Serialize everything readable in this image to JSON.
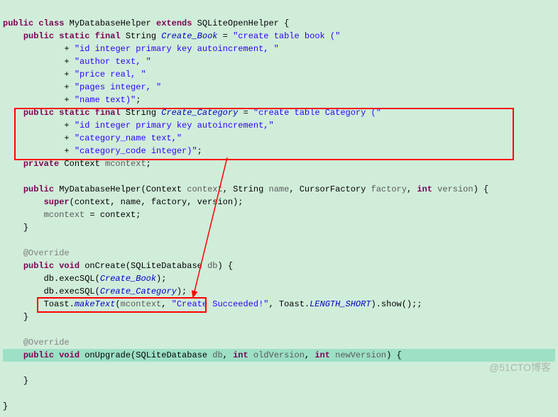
{
  "line1": {
    "a": "public class ",
    "b": "MyDatabaseHelper ",
    "c": "extends ",
    "d": "SQLiteOpenHelper {"
  },
  "line2": {
    "a": "public static final ",
    "b": "String ",
    "c": "Create_Book",
    "d": " = ",
    "e": "\"create table book (\""
  },
  "line3": {
    "a": "+ ",
    "b": "\"id integer primary key autoincrement, \""
  },
  "line4": {
    "a": "+ ",
    "b": "\"author text, \""
  },
  "line5": {
    "a": "+ ",
    "b": "\"price real, \""
  },
  "line6": {
    "a": "+ ",
    "b": "\"pages integer, \""
  },
  "line7": {
    "a": "+ ",
    "b": "\"name text)\"",
    "c": ";"
  },
  "line8": {
    "a": "public static final ",
    "b": "String ",
    "c": "Create_Category",
    "d": " = ",
    "e": "\"create table Category (\""
  },
  "line9": {
    "a": "+ ",
    "b": "\"id integer primary key autoincrement,\""
  },
  "line10": {
    "a": "+ ",
    "b": "\"category_name text,\""
  },
  "line11": {
    "a": "+ ",
    "b": "\"category_code integer)\"",
    "c": ";"
  },
  "line12": {
    "a": "private ",
    "b": "Context ",
    "c": "mcontext",
    "d": ";"
  },
  "line13": {
    "a": "public ",
    "b": "MyDatabaseHelper(Context ",
    "c": "context",
    "d": ", String ",
    "e": "name",
    "f": ", CursorFactory ",
    "g": "factory",
    "h": ", ",
    "i": "int ",
    "j": "version",
    "k": ") {"
  },
  "line14": {
    "a": "super",
    "b": "(context, name, factory, version);"
  },
  "line15": {
    "a": "mcontext",
    "b": " = context;"
  },
  "line16": {
    "a": "}"
  },
  "line17": {
    "a": "@Override"
  },
  "line18": {
    "a": "public void ",
    "b": "onCreate(SQLiteDatabase ",
    "c": "db",
    "d": ") {"
  },
  "line19": {
    "a": "db.execSQL(",
    "b": "Create_Book",
    "c": ");"
  },
  "line20": {
    "a": "db.execSQL(",
    "b": "Create_Category",
    "c": ");"
  },
  "line21": {
    "a": "Toast.",
    "b": "makeText",
    "c": "(",
    "d": "mcontext",
    "e": ", ",
    "f": "\"Create Succeeded!\"",
    "g": ", Toast.",
    "h": "LENGTH_SHORT",
    "i": ").show();;"
  },
  "line22": {
    "a": "}"
  },
  "line23": {
    "a": "@Override"
  },
  "line24": {
    "a": "public void ",
    "b": "onUpgrade(SQLiteDatabase ",
    "c": "db",
    "d": ", ",
    "e": "int ",
    "f": "oldVersion",
    "g": ", ",
    "h": "int ",
    "i": "newVersion",
    "j": ") {"
  },
  "line25": {
    "a": "}"
  },
  "line26": {
    "a": "}"
  },
  "watermark": "@51CTO博客"
}
